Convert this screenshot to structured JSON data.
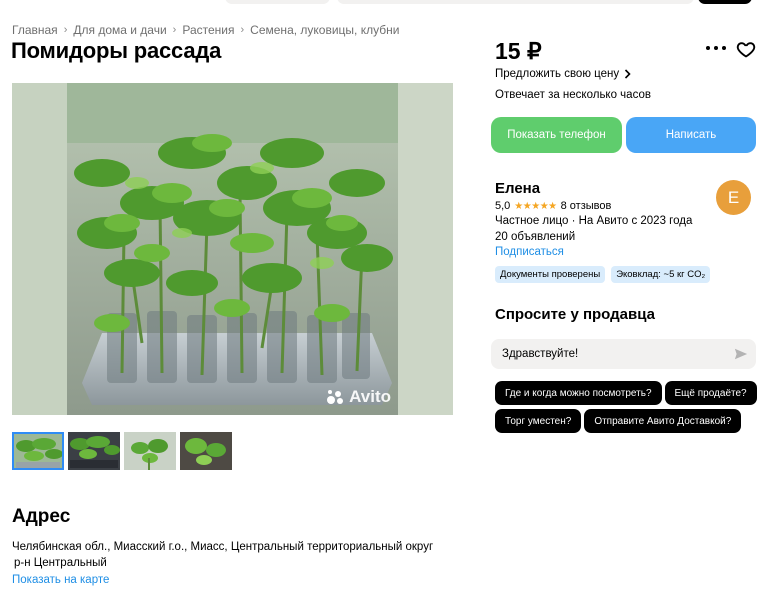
{
  "breadcrumb": [
    {
      "label": "Главная"
    },
    {
      "label": "Для дома и дачи"
    },
    {
      "label": "Растения"
    },
    {
      "label": "Семена, луковицы, клубни"
    }
  ],
  "listing": {
    "title": "Помидоры рассада",
    "price": "15 ₽",
    "offer_price_link": "Предложить свою цену",
    "response_time": "Отвечает за несколько часов",
    "photo_count": 4,
    "active_photo": 1,
    "watermark": "Avito"
  },
  "actions": {
    "show_phone": "Показать телефон",
    "write": "Написать"
  },
  "seller": {
    "name": "Елена",
    "avatar_letter": "Е",
    "rating": "5,0",
    "stars": "★★★★★",
    "reviews": "8 отзывов",
    "type": "Частное лицо · На Авито с 2023 года",
    "listings": "20 объявлений",
    "subscribe": "Подписаться",
    "badges": [
      "Документы проверены",
      "Эковклад: ~5 кг CO₂"
    ]
  },
  "ask": {
    "title": "Спросите у продавца",
    "message": "Здравствуйте!",
    "quick_questions": [
      "Где и когда можно посмотреть?",
      "Ещё продаёте?",
      "Торг уместен?",
      "Отправите Авито Доставкой?"
    ]
  },
  "address": {
    "title": "Адрес",
    "line": "Челябинская обл., Миасский г.о., Миасс, Центральный территориальный округ",
    "district": "р-н Центральный",
    "map_link": "Показать на карте"
  },
  "colors": {
    "green_button": "#5fcd6d",
    "blue_button": "#49a6f6",
    "link": "#1e8ee5",
    "avatar": "#e89f3b",
    "stars": "#f5a623",
    "badge_bg": "#d9ecfc"
  }
}
